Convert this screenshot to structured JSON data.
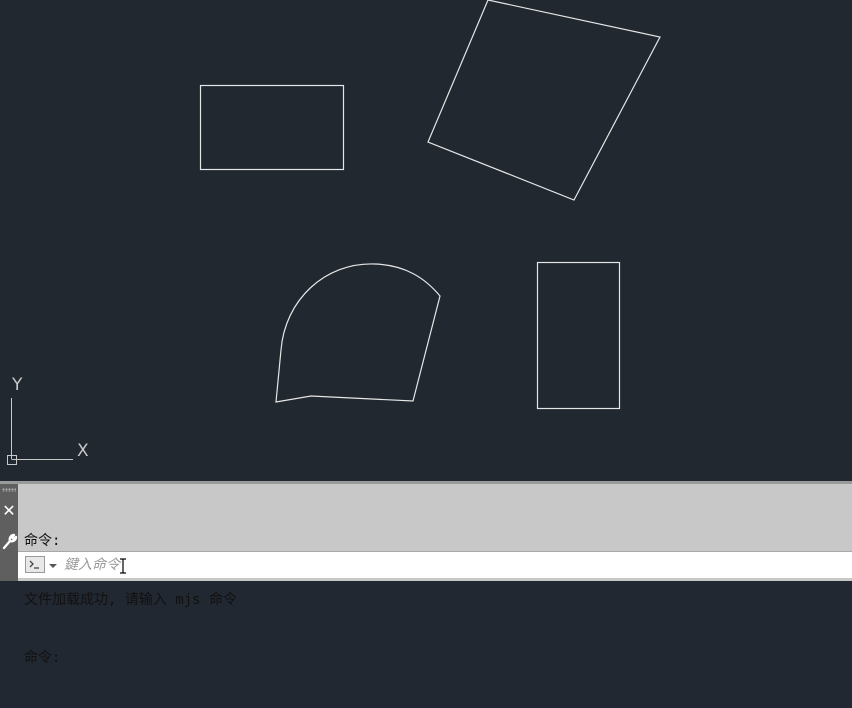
{
  "ucs": {
    "x_label": "X",
    "y_label": "Y"
  },
  "command_line": {
    "history": [
      "命令:",
      "文件加载成功, 请输入 mjs 命令",
      "命令:"
    ],
    "input_placeholder": "鍵入命令",
    "input_value": "",
    "close_glyph": "✕"
  },
  "icons": {
    "close": "close-icon",
    "settings": "wrench-icon",
    "prompt": "command-prompt-icon",
    "dropdown": "chevron-down-icon"
  },
  "colors": {
    "canvas_bg": "#212830",
    "geometry_stroke": "#e6e6e6",
    "panel_bg": "#c8c8c8"
  }
}
